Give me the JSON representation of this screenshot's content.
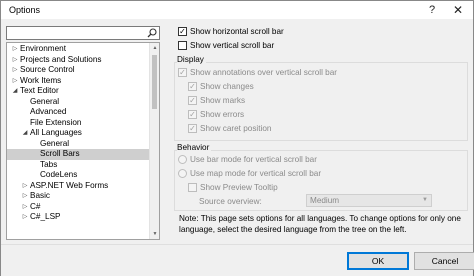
{
  "window": {
    "title": "Options",
    "help_glyph": "?",
    "close_glyph": "✕"
  },
  "search": {
    "placeholder": "",
    "value": ""
  },
  "tree": {
    "items": [
      {
        "label": "Environment",
        "level": 0,
        "expander": "▷",
        "selected": false
      },
      {
        "label": "Projects and Solutions",
        "level": 0,
        "expander": "▷",
        "selected": false
      },
      {
        "label": "Source Control",
        "level": 0,
        "expander": "▷",
        "selected": false
      },
      {
        "label": "Work Items",
        "level": 0,
        "expander": "▷",
        "selected": false
      },
      {
        "label": "Text Editor",
        "level": 0,
        "expander": "◢",
        "selected": false
      },
      {
        "label": "General",
        "level": 1,
        "expander": "",
        "selected": false
      },
      {
        "label": "Advanced",
        "level": 1,
        "expander": "",
        "selected": false
      },
      {
        "label": "File Extension",
        "level": 1,
        "expander": "",
        "selected": false
      },
      {
        "label": "All Languages",
        "level": 1,
        "expander": "◢",
        "selected": false
      },
      {
        "label": "General",
        "level": 2,
        "expander": "",
        "selected": false
      },
      {
        "label": "Scroll Bars",
        "level": 2,
        "expander": "",
        "selected": true
      },
      {
        "label": "Tabs",
        "level": 2,
        "expander": "",
        "selected": false
      },
      {
        "label": "CodeLens",
        "level": 2,
        "expander": "",
        "selected": false
      },
      {
        "label": "ASP.NET Web Forms",
        "level": 1,
        "expander": "▷",
        "selected": false
      },
      {
        "label": "Basic",
        "level": 1,
        "expander": "▷",
        "selected": false
      },
      {
        "label": "C#",
        "level": 1,
        "expander": "▷",
        "selected": false
      },
      {
        "label": "C#_LSP",
        "level": 1,
        "expander": "▷",
        "selected": false
      }
    ]
  },
  "options": {
    "show_hscroll": {
      "label": "Show horizontal scroll bar",
      "checked": true
    },
    "show_vscroll": {
      "label": "Show vertical scroll bar",
      "checked": false
    }
  },
  "display": {
    "title": "Display",
    "show_annotations": {
      "label": "Show annotations over vertical scroll bar",
      "checked": true
    },
    "show_changes": {
      "label": "Show changes",
      "checked": true
    },
    "show_marks": {
      "label": "Show marks",
      "checked": true
    },
    "show_errors": {
      "label": "Show errors",
      "checked": true
    },
    "show_caret": {
      "label": "Show caret position",
      "checked": true
    }
  },
  "behavior": {
    "title": "Behavior",
    "bar_mode": {
      "label": "Use bar mode for vertical scroll bar",
      "selected": false
    },
    "map_mode": {
      "label": "Use map mode for vertical scroll bar",
      "selected": false
    },
    "preview_tooltip": {
      "label": "Show Preview Tooltip",
      "checked": false
    },
    "source_overview": {
      "label": "Source overview:",
      "value": "Medium"
    }
  },
  "note": "Note: This page sets options for all languages. To change options for only one language, select the desired language from the tree on the left.",
  "buttons": {
    "ok": "OK",
    "cancel": "Cancel"
  },
  "colors": {
    "accent": "#0078d7",
    "selection": "#cfcfcf",
    "disabled_text": "#8a8a8a"
  }
}
